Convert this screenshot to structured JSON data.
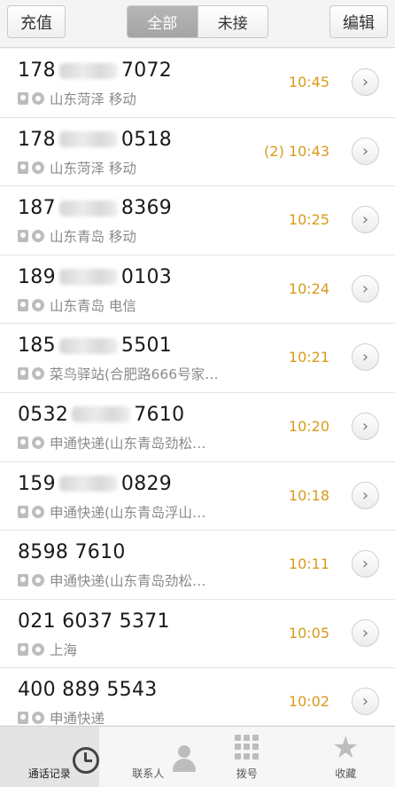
{
  "header": {
    "recharge_label": "充值",
    "tabs": [
      {
        "label": "全部",
        "active": true
      },
      {
        "label": "未接",
        "active": false
      }
    ],
    "edit_label": "编辑"
  },
  "calls": [
    {
      "prefix": "178",
      "suffix": "7072",
      "location": "山东菏泽 移动",
      "time": "10:45"
    },
    {
      "prefix": "178",
      "suffix": "0518",
      "location": "山东菏泽 移动",
      "time": "(2) 10:43"
    },
    {
      "prefix": "187",
      "suffix": "8369",
      "location": "山东青岛 移动",
      "time": "10:25"
    },
    {
      "prefix": "189",
      "suffix": "0103",
      "location": "山东青岛 电信",
      "time": "10:24"
    },
    {
      "prefix": "185",
      "suffix": "5501",
      "location": "菜鸟驿站(合肥路666号家…",
      "time": "10:21"
    },
    {
      "prefix": "0532",
      "suffix": "7610",
      "location": "申通快递(山东青岛劲松…",
      "time": "10:20"
    },
    {
      "prefix": "159",
      "suffix": "0829",
      "location": "申通快递(山东青岛浮山…",
      "time": "10:18"
    },
    {
      "prefix": "8598 7610",
      "suffix": "",
      "location": "申通快递(山东青岛劲松…",
      "time": "10:11"
    },
    {
      "prefix": "021 6037 5371",
      "suffix": "",
      "location": "上海",
      "time": "10:05"
    },
    {
      "prefix": "400 889 5543",
      "suffix": "",
      "location": "申通快递",
      "time": "10:02"
    }
  ],
  "tabbar": [
    {
      "label": "通话记录",
      "icon": "clock-icon",
      "active": true
    },
    {
      "label": "联系人",
      "icon": "person-icon",
      "active": false
    },
    {
      "label": "拨号",
      "icon": "keypad-icon",
      "active": false
    },
    {
      "label": "收藏",
      "icon": "star-icon",
      "active": false
    }
  ],
  "colors": {
    "time": "#d99a1a",
    "active_segment": "#a9a9a9"
  }
}
